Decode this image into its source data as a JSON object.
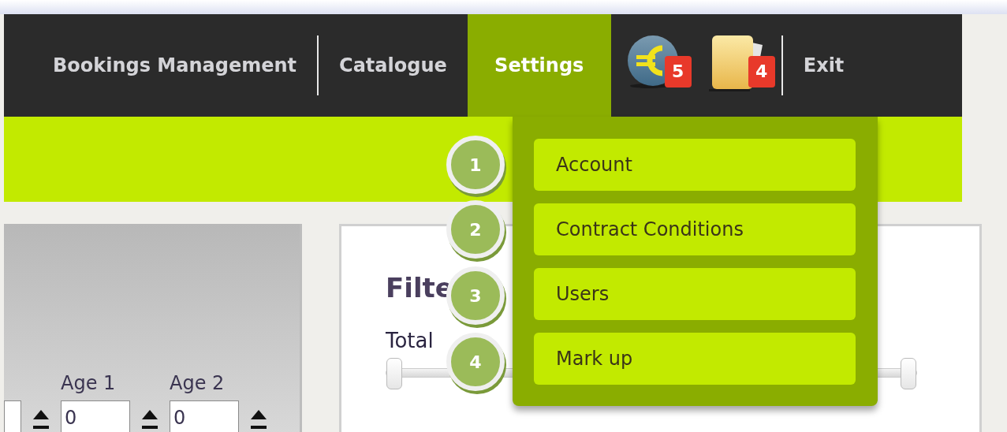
{
  "nav": {
    "items": [
      {
        "kind": "link",
        "label": "Bookings Management",
        "selected": false
      },
      {
        "kind": "link",
        "label": "Catalogue",
        "selected": false
      },
      {
        "kind": "link",
        "label": "Settings",
        "selected": true
      },
      {
        "kind": "coin",
        "badge": "5"
      },
      {
        "kind": "folder",
        "badge": "4"
      },
      {
        "kind": "link",
        "label": "Exit",
        "selected": false
      }
    ]
  },
  "settings_menu": {
    "items": [
      "Account",
      "Contract Conditions",
      "Users",
      "Mark up"
    ]
  },
  "annotations": [
    "1",
    "2",
    "3",
    "4"
  ],
  "guests": {
    "fields": [
      {
        "kind": "cut"
      },
      {
        "kind": "age",
        "label": "Age 1",
        "value": "0"
      },
      {
        "kind": "age",
        "label": "Age 2",
        "value": "0"
      }
    ]
  },
  "filter": {
    "title": "Filte",
    "slider": {
      "label": "Total",
      "level": 1
    }
  }
}
